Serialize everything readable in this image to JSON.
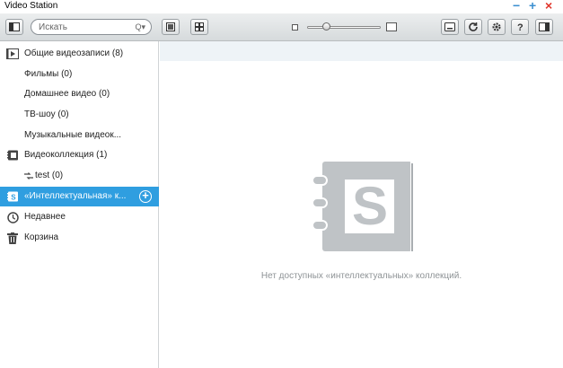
{
  "window": {
    "title": "Video Station",
    "controls": {
      "minimize": "−",
      "maximize": "+",
      "close": "×"
    }
  },
  "toolbar": {
    "search": {
      "placeholder": "Искать",
      "icon": "Q▾"
    }
  },
  "sidebar": {
    "items": [
      {
        "label": "Общие видеозаписи (8)",
        "icon": "video-folder-icon"
      },
      {
        "label": "Фильмы (0)"
      },
      {
        "label": "Домашнее видео (0)"
      },
      {
        "label": "ТВ-шоу (0)"
      },
      {
        "label": "Музыкальные видеок..."
      },
      {
        "label": "Видеоколлекция (1)",
        "icon": "collection-icon"
      },
      {
        "label": "test (0)",
        "icon": "shuffle-icon"
      },
      {
        "label": "«Интеллектуальная» к...",
        "icon": "smart-collection-icon",
        "selected": true
      },
      {
        "label": "Недавнее",
        "icon": "clock-icon"
      },
      {
        "label": "Корзина",
        "icon": "trash-icon"
      }
    ],
    "add_label": "+"
  },
  "main": {
    "empty_message": "Нет доступных «интеллектуальных» коллекций.",
    "empty_icon_letter": "S"
  },
  "colors": {
    "accent": "#2f9ee0",
    "close": "#e0352b",
    "window_ctl": "#3b8fd0"
  }
}
